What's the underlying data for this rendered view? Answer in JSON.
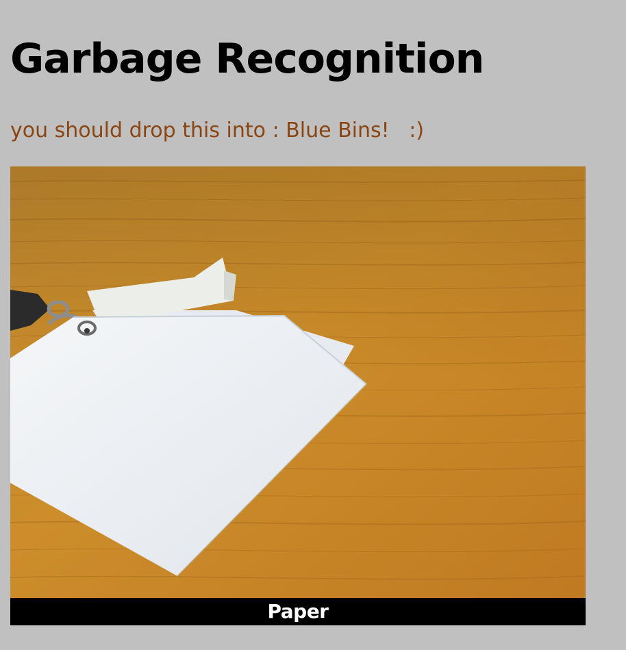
{
  "header": {
    "title": "Garbage Recognition"
  },
  "result": {
    "message": "you should drop this into : Blue Bins!   :)",
    "message_color": "#8b4513"
  },
  "camera": {
    "prediction_label": "Paper",
    "subject": "white paper sheets on lanyard clip",
    "background_color": "#c98a2c"
  },
  "page": {
    "background_color": "#c0c0c0"
  }
}
